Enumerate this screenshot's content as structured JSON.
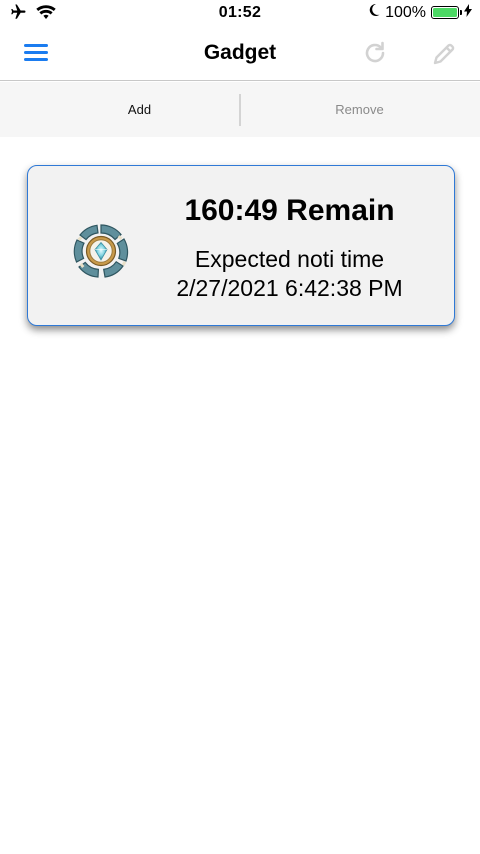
{
  "status_bar": {
    "time": "01:52",
    "battery_percent": "100%",
    "battery_level": 1.0,
    "battery_color": "#4cd964",
    "icons": [
      "airplane-icon",
      "wifi-icon",
      "moon-icon",
      "battery-icon",
      "charging-bolt-icon"
    ]
  },
  "nav": {
    "title": "Gadget",
    "accent": "#1b7cf0",
    "icons": [
      "hamburger-menu-icon",
      "refresh-icon",
      "pencil-edit-icon"
    ]
  },
  "segments": {
    "add": "Add",
    "remove": "Remove"
  },
  "gadget": {
    "remain": "160:49 Remain",
    "expected_label": "Expected noti time",
    "expected_time": "2/27/2021 6:42:38 PM",
    "icon": "gadget-gear-icon",
    "border_color": "#2f79d6"
  }
}
